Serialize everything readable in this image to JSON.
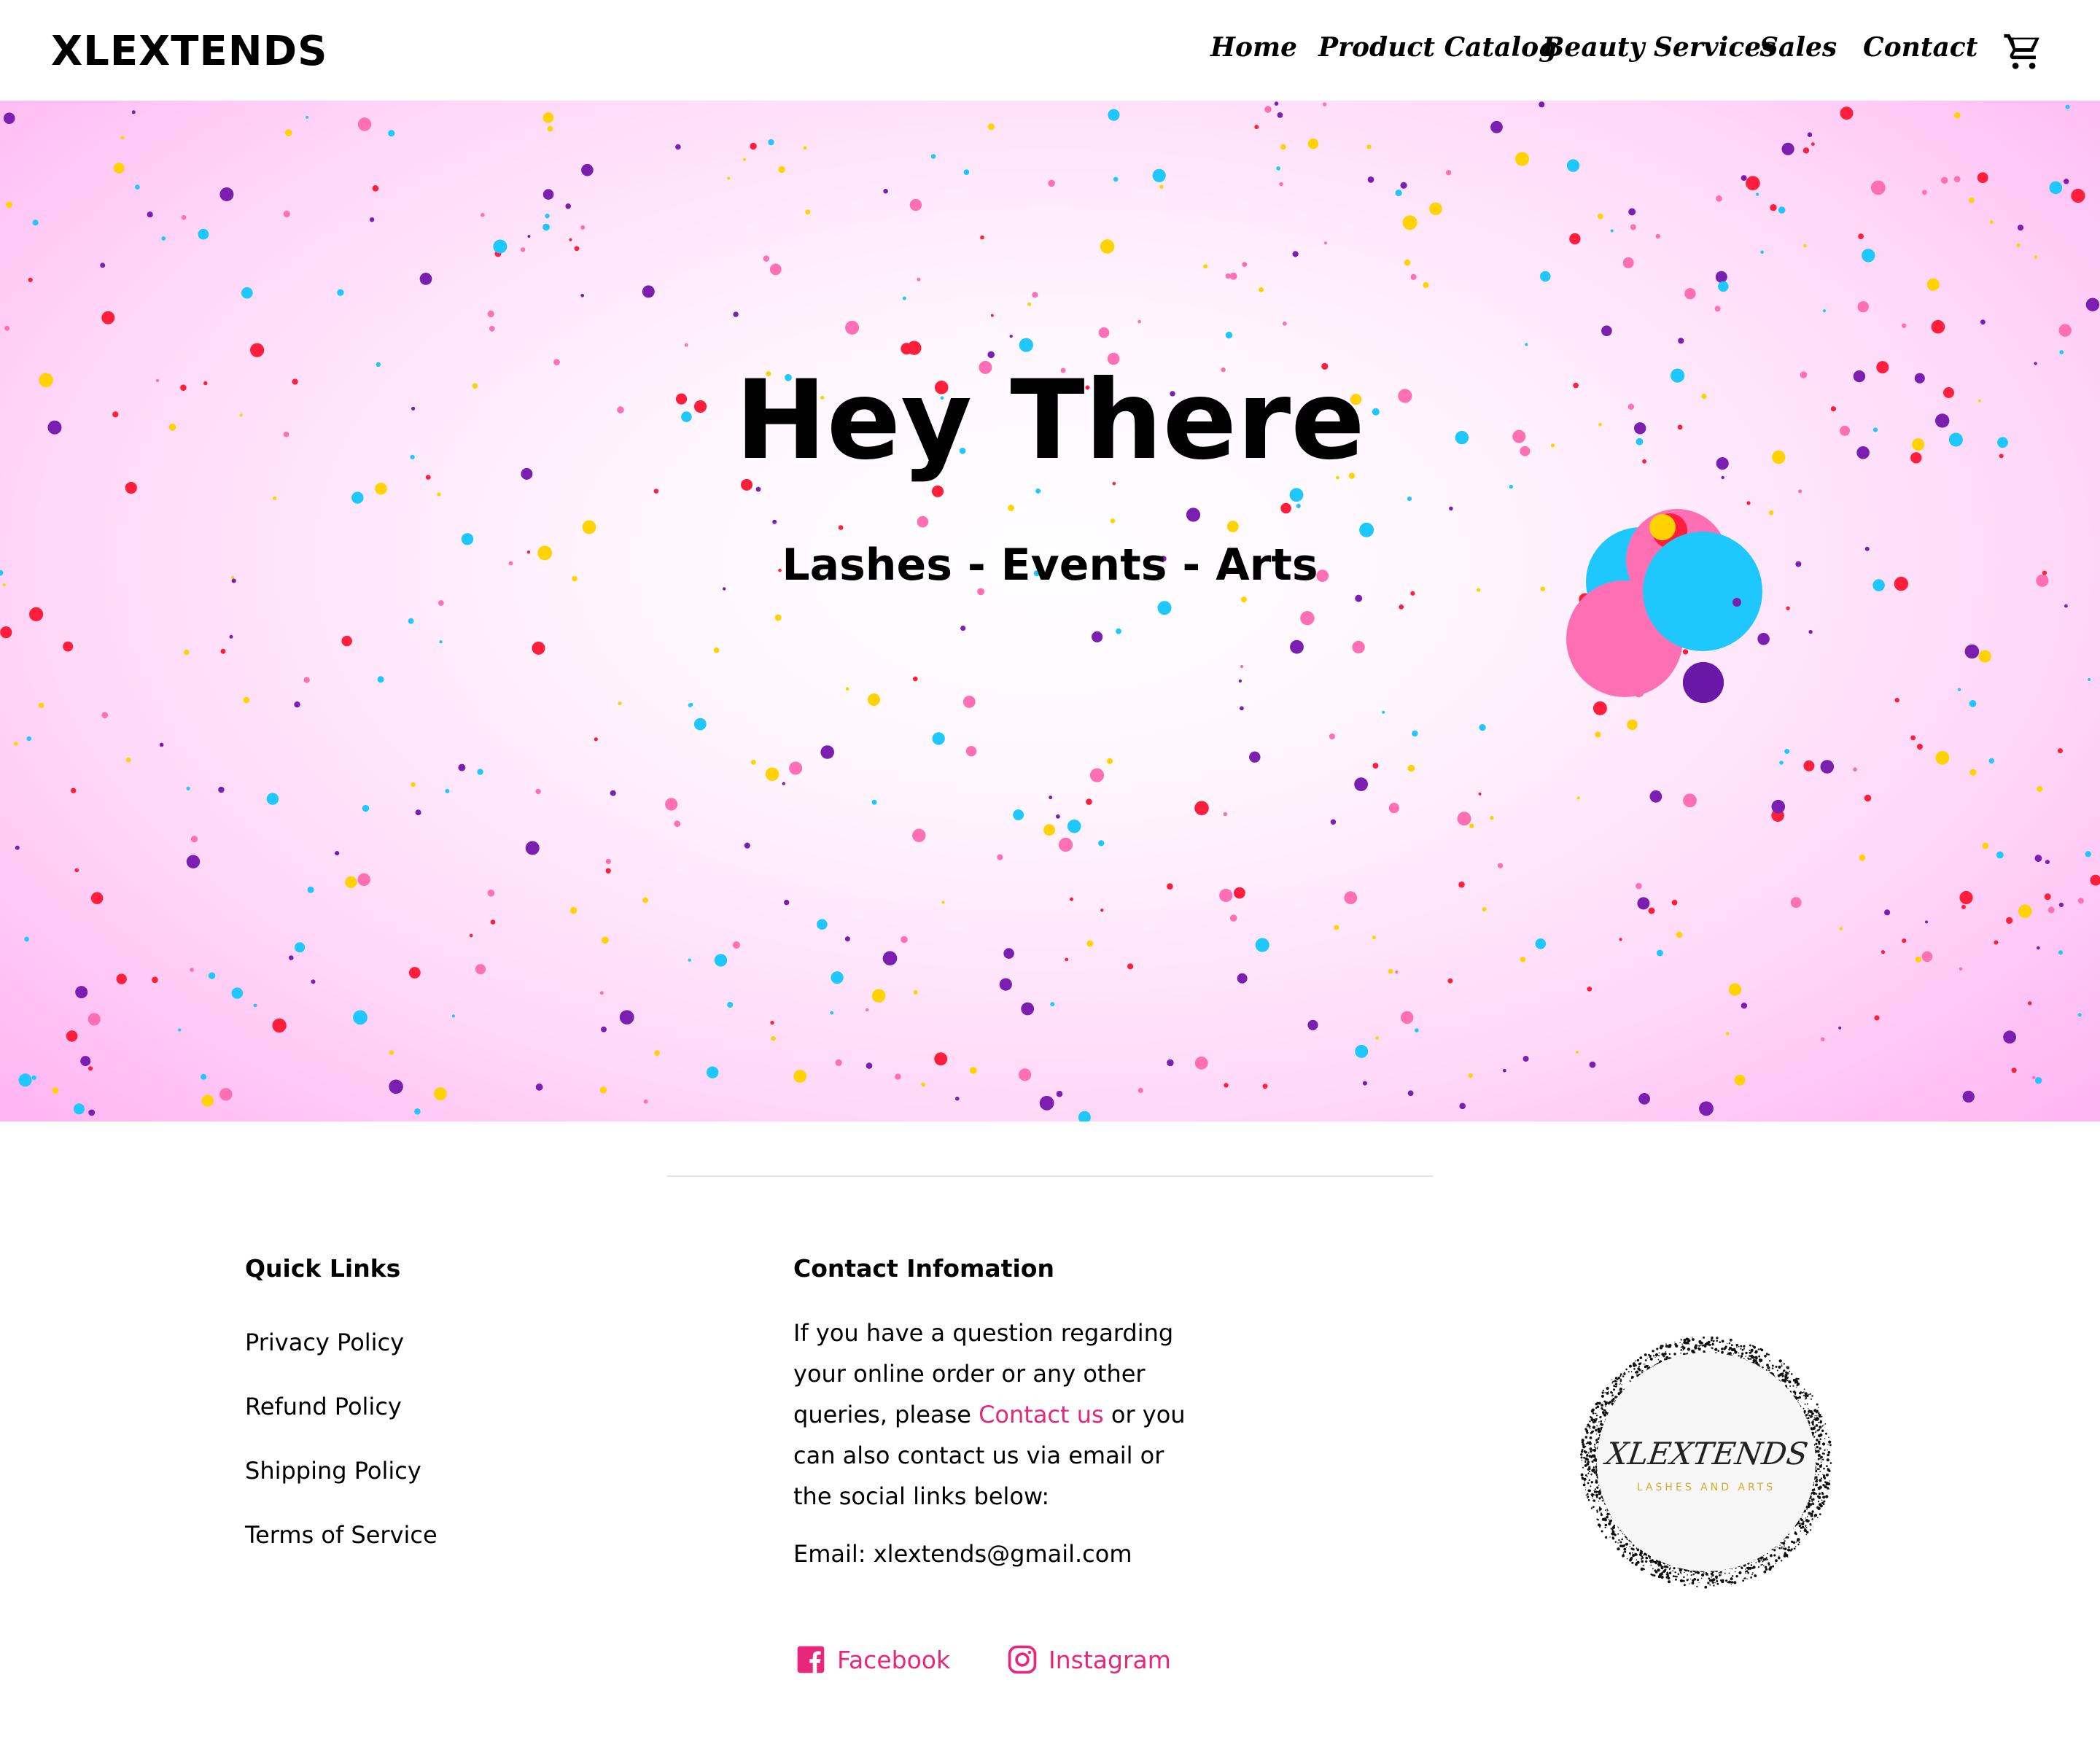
{
  "header": {
    "brand": "XLEXTENDS",
    "nav": [
      {
        "label": "Home"
      },
      {
        "label": "Product Catalog"
      },
      {
        "label": "Beauty Services"
      },
      {
        "label": "Sales"
      },
      {
        "label": "Contact"
      }
    ],
    "cart_icon": "shopping-cart-icon"
  },
  "hero": {
    "title": "Hey There",
    "subtitle": "Lashes - Events - Arts",
    "confetti_colors": [
      "#ff1f3d",
      "#7a1fb0",
      "#ffd200",
      "#1ec8ff",
      "#ff6fb4"
    ]
  },
  "footer": {
    "quick_links": {
      "heading": "Quick Links",
      "links": [
        "Privacy Policy",
        "Refund Policy",
        "Shipping Policy",
        "Terms of Service"
      ]
    },
    "contact": {
      "heading": "Contact Infomation",
      "text_before": "If you have a question regarding your online order or any other queries, please ",
      "link": "Contact us",
      "text_after": " or you can also contact us via email or the social links below:",
      "email": "Email: xlextends@gmail.com",
      "social": [
        {
          "label": "Facebook",
          "icon": "facebook-icon"
        },
        {
          "label": "Instagram",
          "icon": "instagram-icon"
        }
      ]
    },
    "logo": {
      "name": "XLEXTENDS",
      "tagline": "LASHES AND ARTS"
    }
  },
  "colors": {
    "accent": "#e8277b",
    "hero_edge": "#ffb6f3"
  }
}
